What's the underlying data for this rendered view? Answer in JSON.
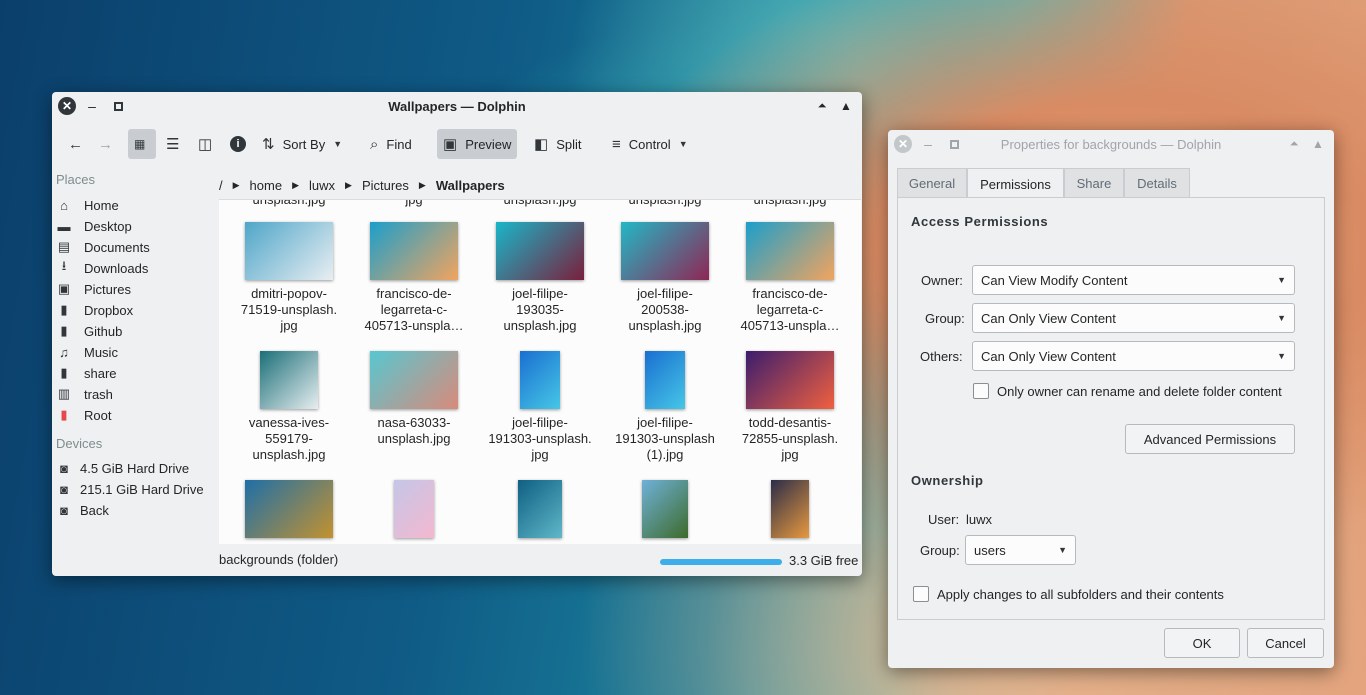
{
  "dolphin": {
    "title": "Wallpapers — Dolphin",
    "toolbar": {
      "sort_by": "Sort By",
      "find": "Find",
      "preview": "Preview",
      "split": "Split",
      "control": "Control"
    },
    "places_heading": "Places",
    "places": [
      "Home",
      "Desktop",
      "Documents",
      "Downloads",
      "Pictures",
      "Dropbox",
      "Github",
      "Music",
      "share",
      "trash",
      "Root"
    ],
    "devices_heading": "Devices",
    "devices": [
      "4.5 GiB Hard Drive",
      "215.1 GiB Hard Drive",
      "Back"
    ],
    "breadcrumb": {
      "root": "/",
      "items": [
        "home",
        "luwx",
        "Pictures"
      ],
      "current": "Wallpapers"
    },
    "partial_row": [
      "unsplash.jpg",
      "jpg",
      "unsplash.jpg",
      "unsplash.jpg",
      "unsplash.jpg"
    ],
    "files": [
      {
        "name": "dmitri-popov-\n71519-unsplash.\njpg",
        "colors": [
          "#4fa6c9",
          "#e9eef2"
        ]
      },
      {
        "name": "francisco-de-\nlegarreta-c-\n405713-unspla…",
        "colors": [
          "#1b9fcb",
          "#f2a45e"
        ]
      },
      {
        "name": "joel-filipe-\n193035-\nunsplash.jpg",
        "colors": [
          "#19b6c9",
          "#7a1f3c"
        ]
      },
      {
        "name": "joel-filipe-\n200538-\nunsplash.jpg",
        "colors": [
          "#21b8c6",
          "#8f2655"
        ]
      },
      {
        "name": "francisco-de-\nlegarreta-c-\n405713-unspla…",
        "colors": [
          "#1b9fcb",
          "#f2a45e"
        ]
      },
      {
        "name": "vanessa-ives-\n559179-\nunsplash.jpg",
        "colors": [
          "#1b6f78",
          "#e7eef0"
        ]
      },
      {
        "name": "nasa-63033-\nunsplash.jpg",
        "colors": [
          "#57c7d1",
          "#d98a7a"
        ]
      },
      {
        "name": "joel-filipe-\n191303-unsplash.\njpg",
        "colors": [
          "#1a6fd1",
          "#46c7e6"
        ]
      },
      {
        "name": "joel-filipe-\n191303-unsplash\n(1).jpg",
        "colors": [
          "#1a6fd1",
          "#46c7e6"
        ]
      },
      {
        "name": "todd-desantis-\n72855-unsplash.\njpg",
        "colors": [
          "#3b1d6e",
          "#f0603f"
        ]
      },
      {
        "name": "",
        "colors": [
          "#1e6fa8",
          "#c3922f"
        ]
      },
      {
        "name": "",
        "colors": [
          "#c5c6e8",
          "#f3b8cf"
        ]
      },
      {
        "name": "",
        "colors": [
          "#0f5f83",
          "#5fb8c8"
        ]
      },
      {
        "name": "",
        "colors": [
          "#6fb1d9",
          "#3d6b2b"
        ]
      },
      {
        "name": "",
        "colors": [
          "#2b2d48",
          "#e8993e"
        ]
      }
    ],
    "status": "backgrounds (folder)",
    "free_space": "3.3 GiB free",
    "space_used_fraction": 0.98
  },
  "properties": {
    "title": "Properties for backgrounds — Dolphin",
    "tabs": [
      "General",
      "Permissions",
      "Share",
      "Details"
    ],
    "access_heading": "Access Permissions",
    "owner_label": "Owner:",
    "owner_value": "Can View  Modify Content",
    "group_label": "Group:",
    "group_value": "Can Only View Content",
    "others_label": "Others:",
    "others_value": "Can Only View Content",
    "rename_checkbox": "Only owner can rename and delete folder content",
    "advanced_button": "Advanced Permissions",
    "ownership_heading": "Ownership",
    "user_label": "User:",
    "user_value": "luwx",
    "group2_label": "Group:",
    "group2_value": "users",
    "apply_checkbox": "Apply changes to all subfolders and their contents",
    "ok": "OK",
    "cancel": "Cancel"
  }
}
